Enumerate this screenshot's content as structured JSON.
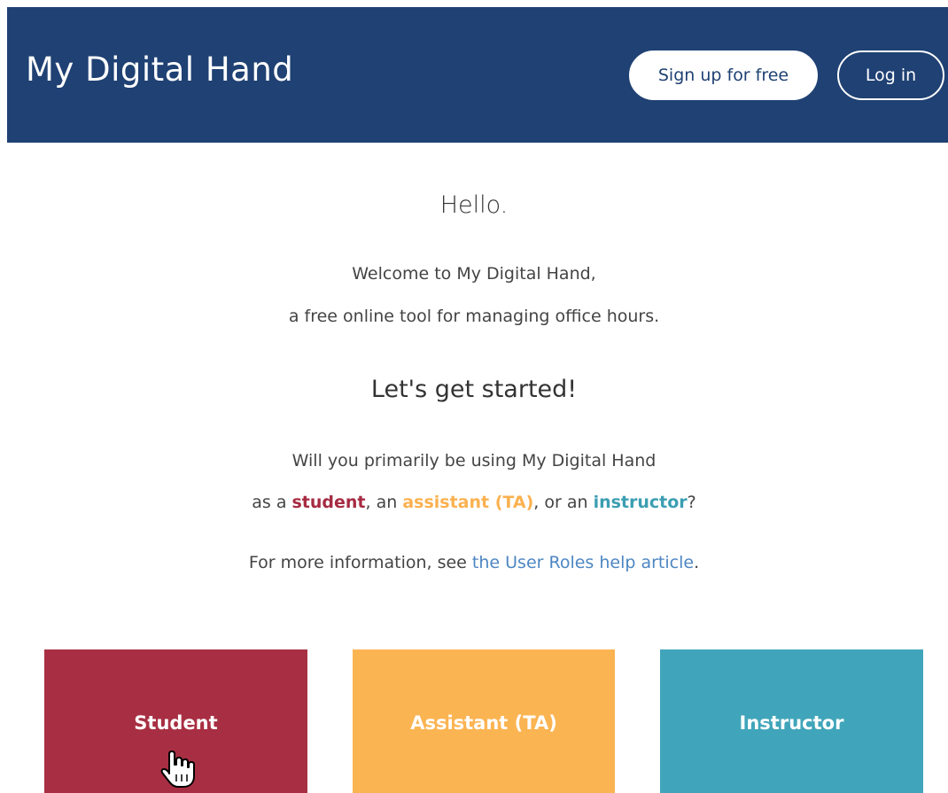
{
  "header": {
    "brand": "My Digital Hand",
    "signup_label": "Sign up for free",
    "login_label": "Log in"
  },
  "intro": {
    "greeting": "Hello.",
    "welcome_line1": "Welcome to My Digital Hand,",
    "welcome_line2": "a free online tool for managing office hours.",
    "started": "Let's get started!",
    "question_line1": "Will you primarily be using My Digital Hand",
    "question_prefix": "as a ",
    "student_word": "student",
    "sep1": ", an ",
    "assistant_word": "assistant (TA)",
    "sep2": ", or an ",
    "instructor_word": "instructor",
    "question_suffix": "?",
    "moreinfo_prefix": "For more information, see ",
    "help_link": "the User Roles help article",
    "moreinfo_suffix": "."
  },
  "roles": [
    {
      "label": "Student",
      "color": "#a82f43"
    },
    {
      "label": "Assistant (TA)",
      "color": "#fbb452"
    },
    {
      "label": "Instructor",
      "color": "#40a5ba"
    }
  ],
  "cursor": {
    "icon": "hand-pointer-cursor-icon"
  },
  "colors": {
    "header_bg": "#1f4173",
    "student": "#a62b42",
    "assistant": "#fbb150",
    "instructor": "#3b9eb2",
    "link": "#4d86c2"
  }
}
